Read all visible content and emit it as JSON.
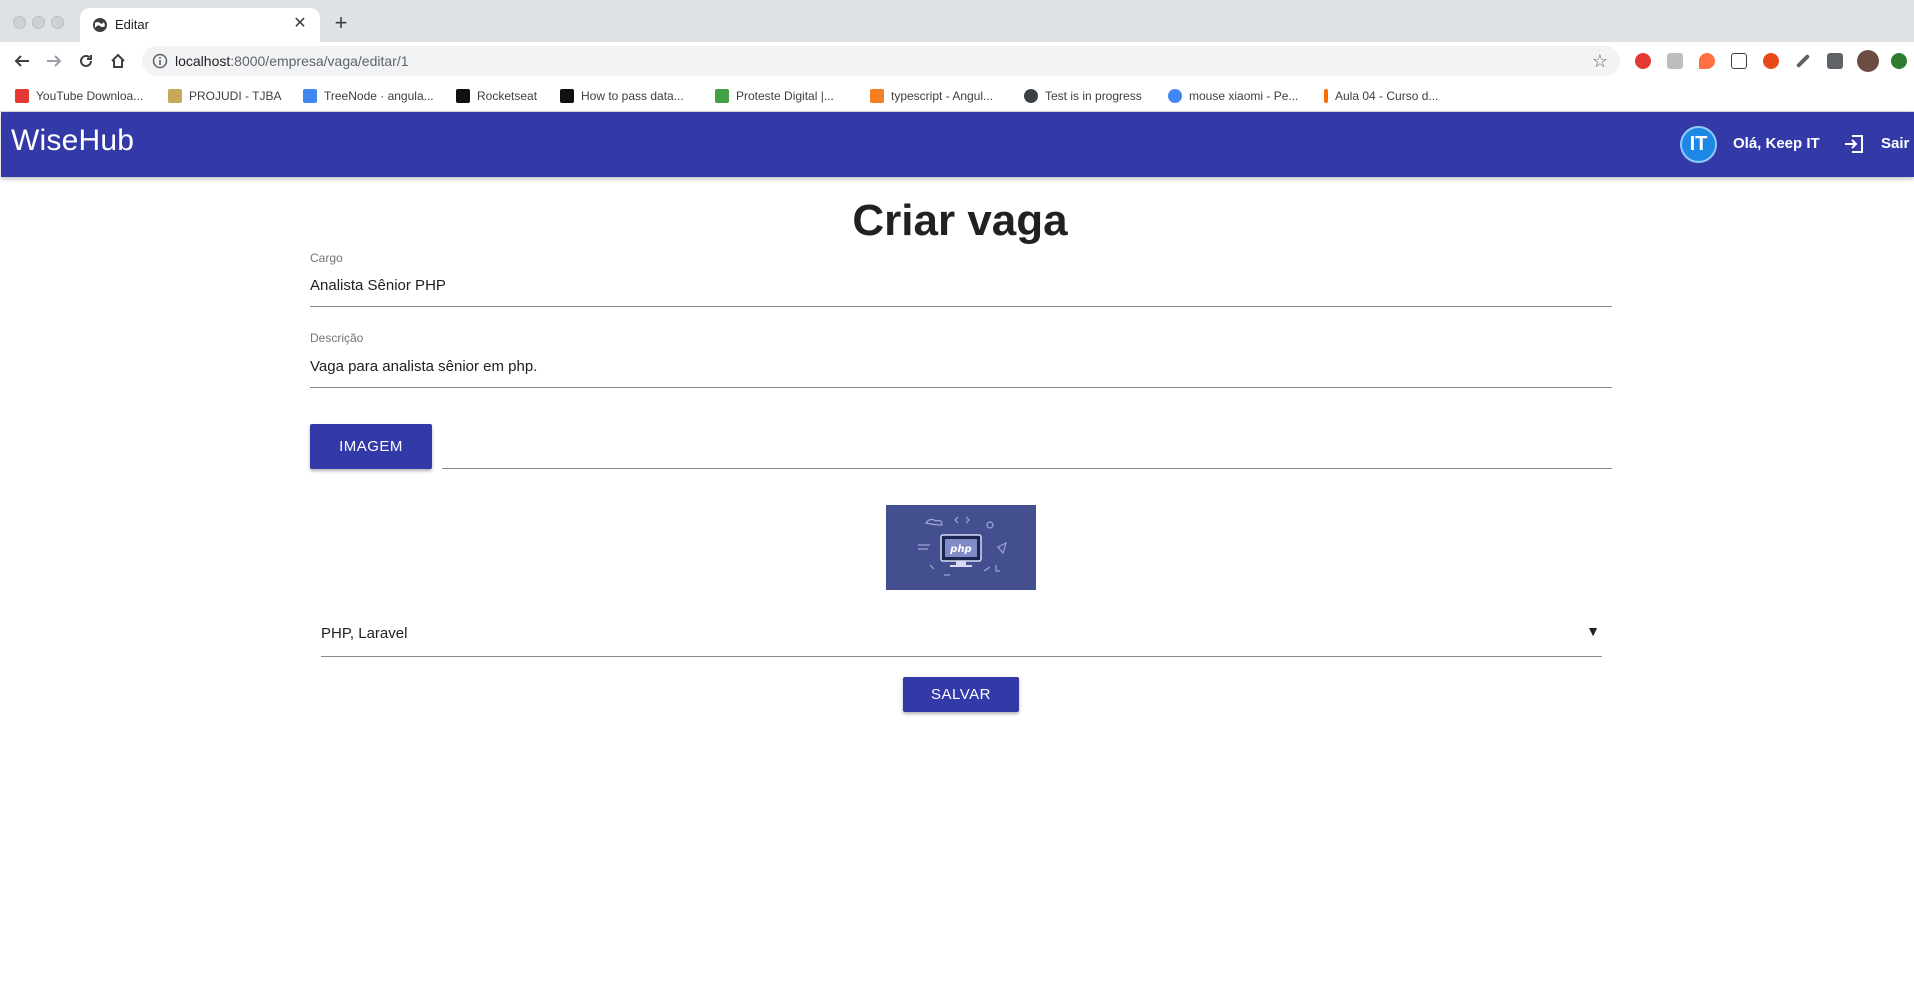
{
  "browser": {
    "tab": {
      "title": "Editar",
      "favicon": "globe-icon",
      "close_glyph": "✕"
    },
    "new_tab_glyph": "+",
    "url": {
      "host": "localhost",
      "path": ":8000/empresa/vaga/editar/1"
    },
    "bookmarks": [
      {
        "label": "YouTube Downloa...",
        "icon_color": "#e53935"
      },
      {
        "label": "PROJUDI - TJBA",
        "icon_color": "#c8a85a"
      },
      {
        "label": "TreeNode · angula...",
        "icon_color": "#4285f4"
      },
      {
        "label": "Rocketseat",
        "icon_color": "#111111"
      },
      {
        "label": "How to pass data...",
        "icon_color": "#111111"
      },
      {
        "label": "Proteste Digital |...",
        "icon_color": "#43a047"
      },
      {
        "label": "typescript - Angul...",
        "icon_color": "#f48024"
      },
      {
        "label": "Test is in progress",
        "icon_color": "#3c4043"
      },
      {
        "label": "mouse xiaomi - Pe...",
        "icon_color": "#4285f4"
      },
      {
        "label": "Aula 04 - Curso d...",
        "icon_color": "#ff6d00"
      }
    ]
  },
  "header": {
    "brand": "WiseHub",
    "avatar_text": "IT",
    "greeting": "Olá, Keep IT",
    "logout_label": "Sair",
    "color": "#333aa8"
  },
  "form": {
    "title": "Criar vaga",
    "cargo": {
      "label": "Cargo",
      "value": "Analista Sênior PHP"
    },
    "descricao": {
      "label": "Descrição",
      "value": "Vaga para analista sênior em php."
    },
    "image_button": "IMAGEM",
    "preview_text": "php",
    "skills": {
      "value": "PHP, Laravel",
      "arrow": "▼"
    },
    "save_button": "SALVAR"
  }
}
